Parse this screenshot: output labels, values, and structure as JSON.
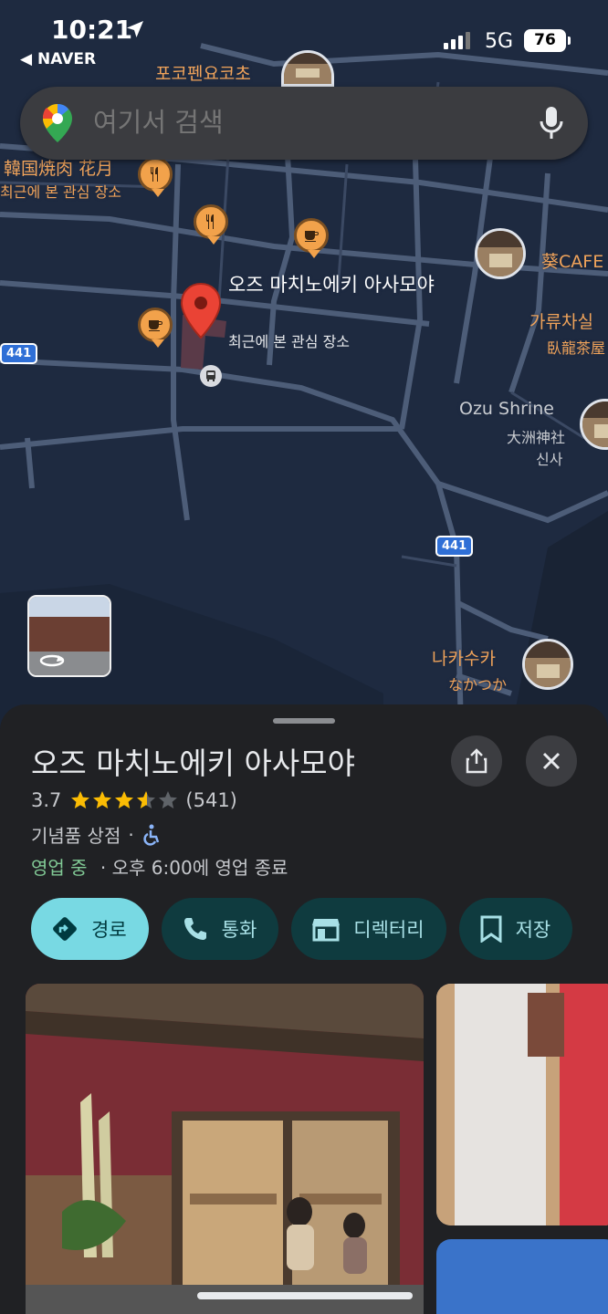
{
  "status_bar": {
    "time": "10:21",
    "back_app": "◀ NAVER",
    "network": "5G",
    "battery": "76"
  },
  "search": {
    "placeholder": "여기서 검색"
  },
  "map": {
    "labels": {
      "pokopen": "포코펜요코초",
      "korean_bbq": "韓国焼肉 花月",
      "recent_saved_1": "최근에 본 관심 장소",
      "aoi_cafe": "葵CAFE",
      "garyu_kr": "가류차실",
      "garyu_jp": "臥龍茶屋",
      "ozu_shrine": "Ozu Shrine",
      "ozu_shrine_jp": "大洲神社",
      "ozu_shrine_kr": "신사",
      "nakatsuka_kr": "나카수카",
      "nakatsuka_jp": "なかつか",
      "route_441a": "441",
      "route_441b": "441"
    },
    "pin": {
      "name": "오즈 마치노에키 아사모야",
      "sub": "최근에 본 관심 장소"
    }
  },
  "place": {
    "title": "오즈 마치노에키 아사모야",
    "rating": "3.7",
    "rating_value": 3.7,
    "review_count": "(541)",
    "category": "기념품 상점",
    "separator": "·",
    "open_status": "영업 중",
    "hours": "· 오후 6:00에 영업 종료"
  },
  "actions": {
    "directions": "경로",
    "call": "통화",
    "directory": "디렉터리",
    "save": "저장"
  },
  "colors": {
    "accent": "#78d9e3",
    "open": "#81c995",
    "star": "#fbbc04",
    "map_bg": "#1e2a40",
    "poi": "#f2a24b",
    "pin": "#ea4335"
  }
}
